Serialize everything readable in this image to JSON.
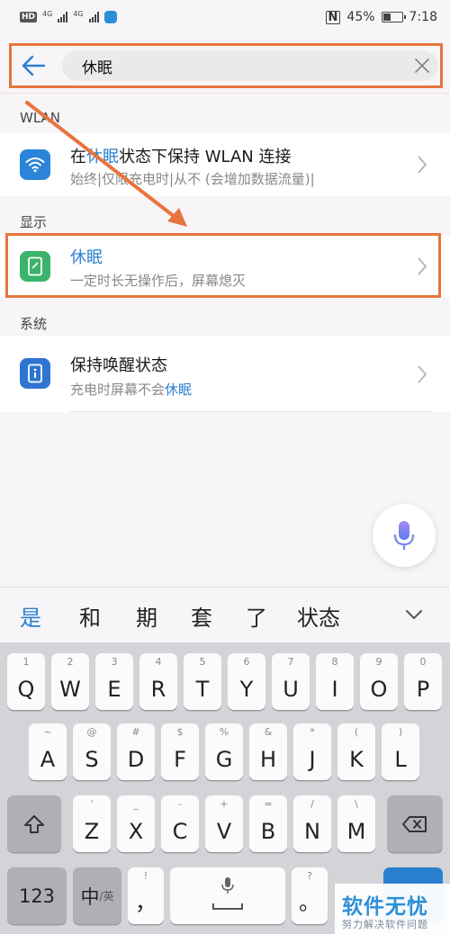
{
  "status_bar": {
    "hd_badge": "HD",
    "net_1": "4G",
    "net_2": "4G",
    "nfc": "N",
    "battery": "45%",
    "battery_level": 0.45,
    "time": "7:18"
  },
  "search": {
    "query": "休眠"
  },
  "sections": {
    "wlan": {
      "label": "WLAN",
      "title_pre": "在",
      "title_hl": "休眠",
      "title_post": "状态下保持 WLAN 连接",
      "subtitle": "始终|仅限充电时|从不 (会增加数据流量)|"
    },
    "display": {
      "label": "显示",
      "title": "休眠",
      "subtitle": "一定时长无操作后，屏幕熄灭"
    },
    "system": {
      "label": "系统",
      "title": "保持唤醒状态",
      "subtitle_pre": "充电时屏幕不会",
      "subtitle_hl": "休眠"
    }
  },
  "candidates": [
    "是",
    "和",
    "期",
    "套",
    "了",
    "状态"
  ],
  "keyboard": {
    "row1": [
      {
        "ch": "Q",
        "sym": "1"
      },
      {
        "ch": "W",
        "sym": "2"
      },
      {
        "ch": "E",
        "sym": "3"
      },
      {
        "ch": "R",
        "sym": "4"
      },
      {
        "ch": "T",
        "sym": "5"
      },
      {
        "ch": "Y",
        "sym": "6"
      },
      {
        "ch": "U",
        "sym": "7"
      },
      {
        "ch": "I",
        "sym": "8"
      },
      {
        "ch": "O",
        "sym": "9"
      },
      {
        "ch": "P",
        "sym": "0"
      }
    ],
    "row2": [
      {
        "ch": "A",
        "sym": "~"
      },
      {
        "ch": "S",
        "sym": "@"
      },
      {
        "ch": "D",
        "sym": "#"
      },
      {
        "ch": "F",
        "sym": "$"
      },
      {
        "ch": "G",
        "sym": "%"
      },
      {
        "ch": "H",
        "sym": "&"
      },
      {
        "ch": "J",
        "sym": "*"
      },
      {
        "ch": "K",
        "sym": "("
      },
      {
        "ch": "L",
        "sym": ")"
      }
    ],
    "row3": [
      {
        "ch": "Z",
        "sym": "'"
      },
      {
        "ch": "X",
        "sym": "_"
      },
      {
        "ch": "C",
        "sym": "-"
      },
      {
        "ch": "V",
        "sym": "+"
      },
      {
        "ch": "B",
        "sym": "="
      },
      {
        "ch": "N",
        "sym": "/"
      },
      {
        "ch": "M",
        "sym": "\\"
      }
    ],
    "key_123": "123",
    "key_lang_cn": "中",
    "key_lang_en": "/英",
    "key_comma": "，",
    "key_comma_sym": "!",
    "key_period": "。",
    "key_period_sym": "?"
  },
  "watermark": {
    "title": "软件无忧",
    "subtitle": "努力解决软件问题"
  },
  "colors": {
    "accent": "#2a7fd0",
    "annotation": "#e8743d",
    "wifi_icon": "#2b84d9",
    "display_icon": "#3cb36a",
    "system_icon": "#2f74d0"
  }
}
